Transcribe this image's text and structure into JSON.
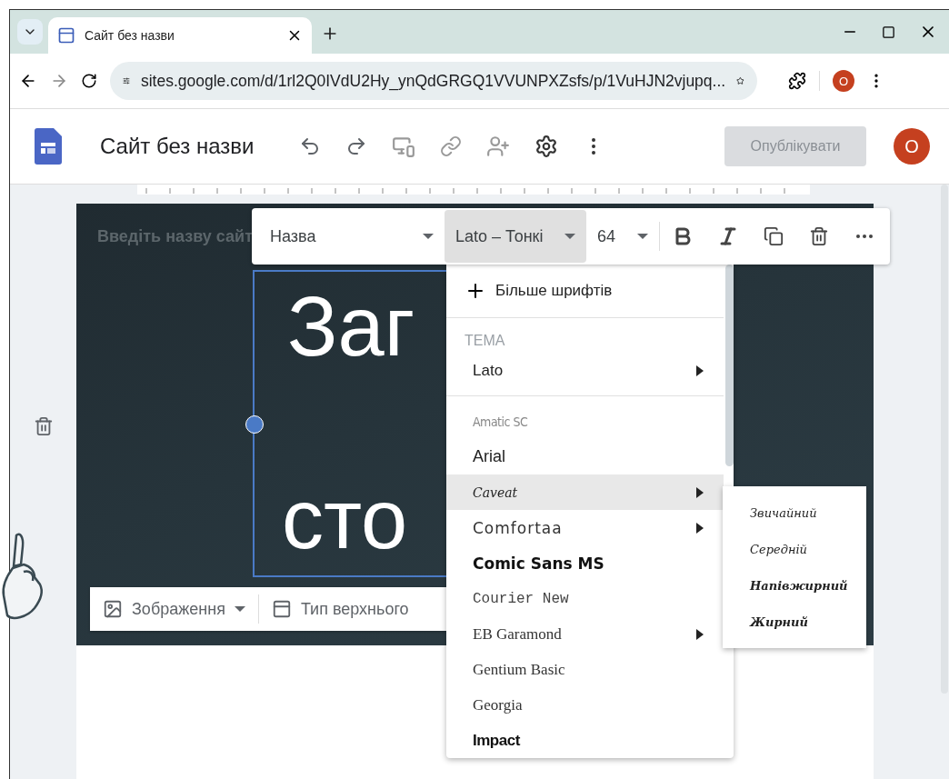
{
  "browser": {
    "tab_title": "Сайт без назви",
    "address": "sites.google.com/d/1rl2Q0IVdU2Hy_ynQdGRGQ1VVUNPXZsfs/p/1VuHJN2vjupq...",
    "profile": "O"
  },
  "app": {
    "title": "Сайт без назви",
    "publish": {
      "label": "Опублікувати",
      "disabled": true
    },
    "avatar": "O"
  },
  "header": {
    "site_name_placeholder": "Введіть назву сайт",
    "title_lines": [
      "Заг",
      "сто"
    ],
    "image_button": "Зображення",
    "header_type_button": "Тип верхнього"
  },
  "text_toolbar": {
    "style": "Назва",
    "font": {
      "label": "Lato – Тонкі",
      "selected": true
    },
    "size": "64"
  },
  "font_menu": {
    "more": "Більше шрифтів",
    "section": "ТЕМА",
    "theme_font": {
      "label": "Lato",
      "submenu": true
    },
    "fonts": [
      {
        "label": "Amatic SC",
        "kind": "thin",
        "submenu": false,
        "selected": false
      },
      {
        "label": "Arial",
        "kind": "sans",
        "submenu": false,
        "selected": false
      },
      {
        "label": "Caveat",
        "kind": "script",
        "submenu": true,
        "selected": true
      },
      {
        "label": "Comfortaa",
        "kind": "rounded",
        "submenu": true,
        "selected": false
      },
      {
        "label": "Comic Sans MS",
        "kind": "comic",
        "submenu": false,
        "selected": false
      },
      {
        "label": "Courier New",
        "kind": "mono",
        "submenu": false,
        "selected": false
      },
      {
        "label": "EB Garamond",
        "kind": "serif",
        "submenu": true,
        "selected": false
      },
      {
        "label": "Gentium Basic",
        "kind": "serif",
        "submenu": false,
        "selected": false
      },
      {
        "label": "Georgia",
        "kind": "serif",
        "submenu": false,
        "selected": false
      },
      {
        "label": "Impact",
        "kind": "display",
        "submenu": false,
        "selected": false
      }
    ]
  },
  "weight_menu": [
    {
      "label": "Звичайний",
      "kind": "regular"
    },
    {
      "label": "Середній",
      "kind": "medium"
    },
    {
      "label": "Напівжирний",
      "kind": "semibold"
    },
    {
      "label": "Жирний",
      "kind": "bold"
    }
  ]
}
